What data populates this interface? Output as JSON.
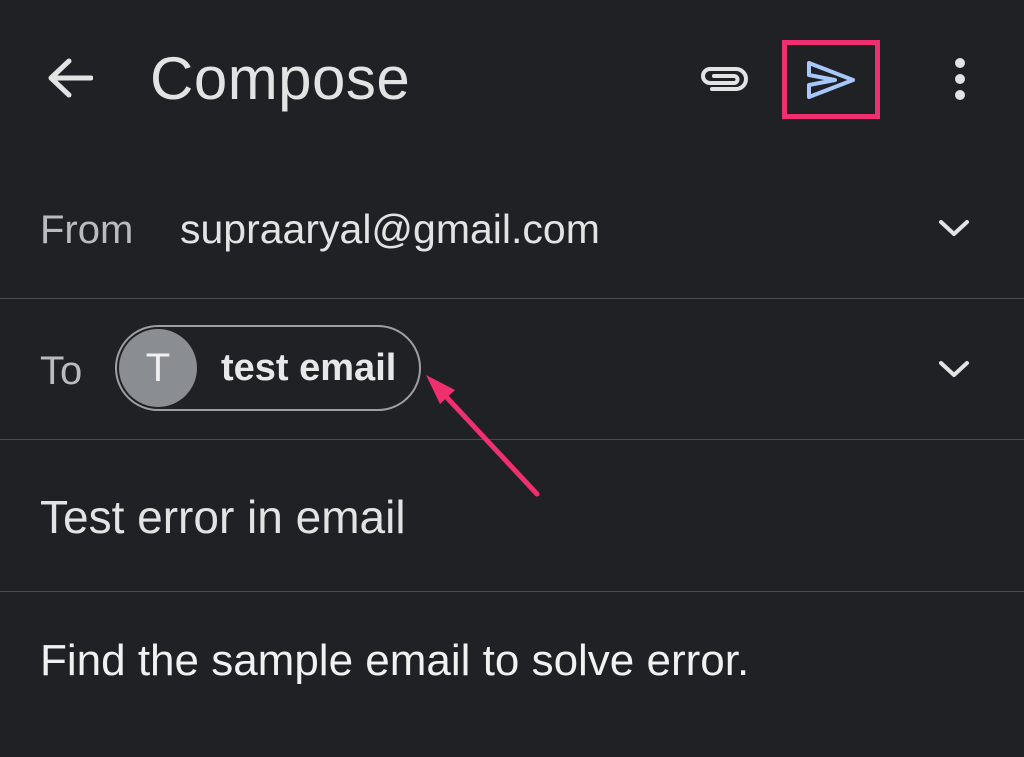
{
  "header": {
    "title": "Compose"
  },
  "icons": {
    "back": "arrow-back-icon",
    "attach": "paperclip-icon",
    "send": "send-icon",
    "more": "more-vertical-icon",
    "chevron": "chevron-down-icon"
  },
  "from": {
    "label": "From",
    "value": "supraaryal@gmail.com"
  },
  "to": {
    "label": "To",
    "recipient": {
      "initial": "T",
      "name": "test email"
    }
  },
  "subject": "Test error in email",
  "body": "Find the sample email to solve error.",
  "colors": {
    "background": "#202124",
    "send_icon": "#a8c7fa",
    "highlight": "#f0306e"
  }
}
